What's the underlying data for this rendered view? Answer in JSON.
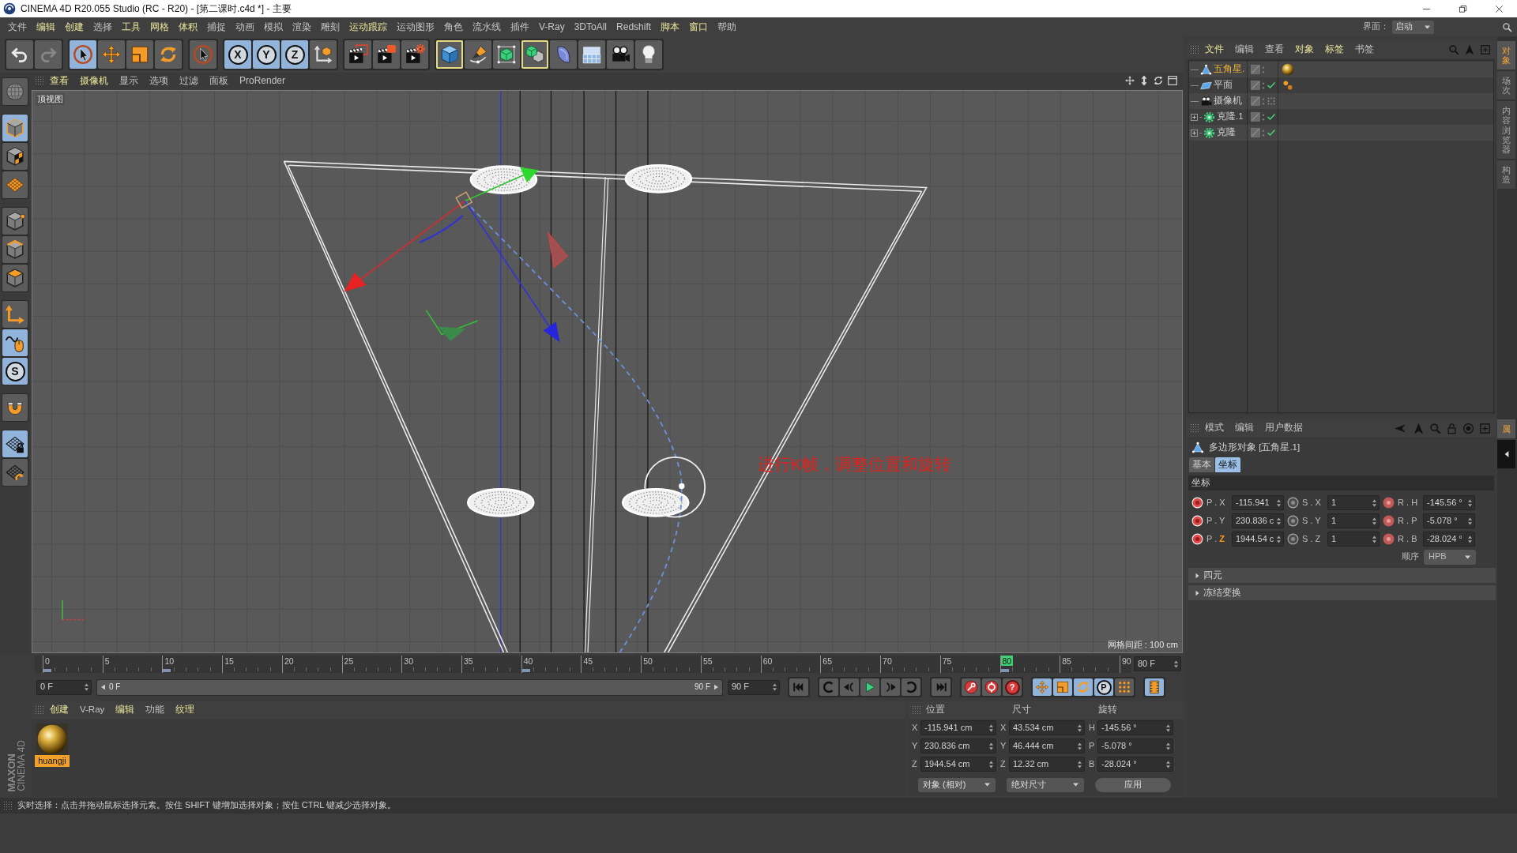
{
  "window": {
    "title": "CINEMA 4D R20.055 Studio (RC - R20) - [第二课时.c4d *] - 主要"
  },
  "menu_bar": {
    "items": [
      {
        "label": "文件",
        "highlighted": false
      },
      {
        "label": "编辑",
        "highlighted": true
      },
      {
        "label": "创建",
        "highlighted": true
      },
      {
        "label": "选择",
        "highlighted": false
      },
      {
        "label": "工具",
        "highlighted": true
      },
      {
        "label": "网格",
        "highlighted": true
      },
      {
        "label": "体积",
        "highlighted": true
      },
      {
        "label": "捕捉",
        "highlighted": false
      },
      {
        "label": "动画",
        "highlighted": false
      },
      {
        "label": "模拟",
        "highlighted": false
      },
      {
        "label": "渲染",
        "highlighted": false
      },
      {
        "label": "雕刻",
        "highlighted": false
      },
      {
        "label": "运动跟踪",
        "highlighted": true
      },
      {
        "label": "运动图形",
        "highlighted": false
      },
      {
        "label": "角色",
        "highlighted": false
      },
      {
        "label": "流水线",
        "highlighted": false
      },
      {
        "label": "插件",
        "highlighted": false
      },
      {
        "label": "V-Ray",
        "highlighted": false
      },
      {
        "label": "3DToAll",
        "highlighted": false
      },
      {
        "label": "Redshift",
        "highlighted": false
      },
      {
        "label": "脚本",
        "highlighted": true
      },
      {
        "label": "窗口",
        "highlighted": true
      },
      {
        "label": "帮助",
        "highlighted": false
      }
    ],
    "layout": {
      "label": "界面：",
      "value": "启动"
    }
  },
  "toolbar": [
    {
      "tools": [
        {
          "kind": "undo",
          "selected": false,
          "highlighted": false,
          "disabled": false
        },
        {
          "kind": "redo",
          "selected": false,
          "highlighted": false,
          "disabled": true
        }
      ]
    },
    {
      "tools": [
        {
          "kind": "select",
          "selected": true,
          "highlighted": false,
          "disabled": false
        },
        {
          "kind": "move",
          "selected": false,
          "highlighted": false,
          "disabled": false
        },
        {
          "kind": "scale",
          "selected": false,
          "highlighted": false,
          "disabled": false
        },
        {
          "kind": "rotate",
          "selected": false,
          "highlighted": false,
          "disabled": false
        }
      ]
    },
    {
      "tools": [
        {
          "kind": "recent",
          "selected": false,
          "highlighted": false,
          "disabled": false
        }
      ]
    },
    {
      "tools": [
        {
          "kind": "axis",
          "glyph": "X",
          "selected": true,
          "highlighted": false,
          "disabled": false
        },
        {
          "kind": "axis",
          "glyph": "Y",
          "selected": true,
          "highlighted": false,
          "disabled": false
        },
        {
          "kind": "axis",
          "glyph": "Z",
          "selected": true,
          "highlighted": false,
          "disabled": false
        },
        {
          "kind": "coords",
          "selected": false,
          "highlighted": false,
          "disabled": false
        }
      ]
    },
    {
      "tools": [
        {
          "kind": "render-view",
          "selected": false,
          "highlighted": false,
          "disabled": false
        },
        {
          "kind": "render-picture",
          "selected": false,
          "highlighted": false,
          "disabled": false
        },
        {
          "kind": "render-settings",
          "selected": false,
          "highlighted": false,
          "disabled": false
        }
      ]
    },
    {
      "tools": [
        {
          "kind": "cube",
          "selected": false,
          "highlighted": true,
          "disabled": false
        },
        {
          "kind": "pen",
          "selected": false,
          "highlighted": false,
          "disabled": false
        },
        {
          "kind": "subdivision",
          "selected": false,
          "highlighted": false,
          "disabled": false
        },
        {
          "kind": "cloner",
          "selected": false,
          "highlighted": true,
          "disabled": false
        },
        {
          "kind": "deformer",
          "selected": false,
          "highlighted": false,
          "disabled": false
        },
        {
          "kind": "floor",
          "selected": false,
          "highlighted": false,
          "disabled": false
        },
        {
          "kind": "camera",
          "selected": false,
          "highlighted": false,
          "disabled": false
        },
        {
          "kind": "light",
          "selected": false,
          "highlighted": false,
          "disabled": false
        }
      ]
    }
  ],
  "mode_toolbar": [
    {
      "tools": [
        {
          "kind": "model",
          "selected": false
        }
      ]
    },
    {
      "tools": [
        {
          "kind": "object",
          "selected": true
        },
        {
          "kind": "texture",
          "selected": false
        },
        {
          "kind": "workplane",
          "selected": false
        }
      ]
    },
    {
      "tools": [
        {
          "kind": "points",
          "selected": false
        },
        {
          "kind": "edges",
          "selected": false
        },
        {
          "kind": "polygons",
          "selected": false
        }
      ]
    },
    {
      "tools": [
        {
          "kind": "axis",
          "selected": false
        },
        {
          "kind": "tweak",
          "selected": true
        },
        {
          "kind": "snap",
          "glyph": "S",
          "selected": true
        }
      ]
    },
    {
      "tools": [
        {
          "kind": "magnet",
          "selected": false
        }
      ]
    },
    {
      "tools": [
        {
          "kind": "workplane-lock",
          "selected": true
        },
        {
          "kind": "planar",
          "selected": false
        }
      ]
    }
  ],
  "viewport": {
    "menu": [
      {
        "label": "查看",
        "highlighted": true
      },
      {
        "label": "摄像机",
        "highlighted": true
      },
      {
        "label": "显示",
        "highlighted": false
      },
      {
        "label": "选项",
        "highlighted": false
      },
      {
        "label": "过滤",
        "highlighted": false
      },
      {
        "label": "面板",
        "highlighted": false
      },
      {
        "label": "ProRender",
        "highlighted": false
      }
    ],
    "view_name": "顶视图",
    "annotation": "进行K帧，调整位置和旋转",
    "grid_spacing": "网格间距 : 100 cm"
  },
  "timeline": {
    "ticks": [
      {
        "label": "0",
        "keyed": true,
        "current": false
      },
      {
        "label": "5",
        "keyed": false,
        "current": false
      },
      {
        "label": "10",
        "keyed": true,
        "current": false
      },
      {
        "label": "15",
        "keyed": false,
        "current": false
      },
      {
        "label": "20",
        "keyed": false,
        "current": false
      },
      {
        "label": "25",
        "keyed": false,
        "current": false
      },
      {
        "label": "30",
        "keyed": false,
        "current": false
      },
      {
        "label": "35",
        "keyed": false,
        "current": false
      },
      {
        "label": "40",
        "keyed": true,
        "current": false
      },
      {
        "label": "45",
        "keyed": false,
        "current": false
      },
      {
        "label": "50",
        "keyed": false,
        "current": false
      },
      {
        "label": "55",
        "keyed": false,
        "current": false
      },
      {
        "label": "60",
        "keyed": false,
        "current": false
      },
      {
        "label": "65",
        "keyed": false,
        "current": false
      },
      {
        "label": "70",
        "keyed": false,
        "current": false
      },
      {
        "label": "75",
        "keyed": false,
        "current": false
      },
      {
        "label": "80",
        "keyed": true,
        "current": true
      },
      {
        "label": "85",
        "keyed": false,
        "current": false
      },
      {
        "label": "90",
        "keyed": false,
        "current": false
      }
    ],
    "current_field": "80 F"
  },
  "transport": {
    "start_field": "0 F",
    "range": {
      "start": "0 F",
      "end": "90 F",
      "level": 1
    },
    "end_field": "90 F",
    "buttons": [
      {
        "buttons": [
          {
            "kind": "go-start",
            "selected": false
          }
        ]
      },
      {
        "buttons": [
          {
            "kind": "prev-key",
            "selected": false
          },
          {
            "kind": "prev-frame",
            "selected": false
          },
          {
            "kind": "play",
            "selected": false
          },
          {
            "kind": "next-frame",
            "selected": false
          },
          {
            "kind": "next-key",
            "selected": false
          }
        ]
      },
      {
        "buttons": [
          {
            "kind": "go-end",
            "selected": false
          }
        ]
      },
      {
        "buttons": [
          {
            "kind": "record",
            "selected": false
          },
          {
            "kind": "autokey",
            "selected": false
          },
          {
            "kind": "key-selection",
            "glyph": "?",
            "selected": false
          }
        ]
      },
      {
        "buttons": [
          {
            "kind": "key-position",
            "selected": true
          },
          {
            "kind": "key-scale",
            "selected": true
          },
          {
            "kind": "key-rotation",
            "selected": true
          },
          {
            "kind": "key-parameter",
            "glyph": "P",
            "selected": true
          },
          {
            "kind": "key-points",
            "selected": false
          }
        ]
      },
      {
        "buttons": [
          {
            "kind": "timeline",
            "selected": true
          }
        ]
      }
    ]
  },
  "material_manager": {
    "menu": [
      {
        "label": "创建",
        "highlighted": true
      },
      {
        "label": "V-Ray",
        "highlighted": false
      },
      {
        "label": "编辑",
        "highlighted": true
      },
      {
        "label": "功能",
        "highlighted": false
      },
      {
        "label": "纹理",
        "highlighted": true
      }
    ],
    "materials": [
      {
        "name": "huangji",
        "selected": true
      }
    ]
  },
  "logo": {
    "lines": [
      "MAXON",
      "CINEMA 4D"
    ]
  },
  "coordinates_manager": {
    "headers": [
      "位置",
      "尺寸",
      "旋转"
    ],
    "rows": [
      {
        "cells": [
          {
            "axis": "X",
            "value": "-115.941 cm"
          },
          {
            "axis": "X",
            "value": "43.534 cm"
          },
          {
            "axis": "H",
            "value": "-145.56 °"
          }
        ]
      },
      {
        "cells": [
          {
            "axis": "Y",
            "value": "230.836 cm"
          },
          {
            "axis": "Y",
            "value": "46.444 cm"
          },
          {
            "axis": "P",
            "value": "-5.078 °"
          }
        ]
      },
      {
        "cells": [
          {
            "axis": "Z",
            "value": "1944.54 cm"
          },
          {
            "axis": "Z",
            "value": "12.32 cm"
          },
          {
            "axis": "B",
            "value": "-28.024 °"
          }
        ]
      }
    ],
    "mode_dropdown": "对象 (相对)",
    "size_dropdown": "绝对尺寸",
    "apply_button": "应用"
  },
  "object_manager": {
    "menu": [
      {
        "label": "文件",
        "highlighted": true
      },
      {
        "label": "编辑",
        "highlighted": false
      },
      {
        "label": "查看",
        "highlighted": false
      },
      {
        "label": "对象",
        "highlighted": true
      },
      {
        "label": "标签",
        "highlighted": true
      },
      {
        "label": "书签",
        "highlighted": false
      }
    ],
    "objects": [
      {
        "name": "五角星.",
        "kind": "polygon",
        "selected": true,
        "enabled": false,
        "tags": [
          {
            "kind": "material"
          }
        ]
      },
      {
        "name": "平面",
        "kind": "plane",
        "selected": false,
        "enabled": true,
        "tags": [
          {
            "kind": "selection"
          }
        ]
      },
      {
        "name": "摄像机",
        "kind": "camera",
        "selected": false,
        "enabled": false
      },
      {
        "name": "克隆.1",
        "kind": "cloner",
        "selected": false,
        "expanded": false,
        "enabled": true
      },
      {
        "name": "克隆",
        "kind": "cloner",
        "selected": false,
        "expanded": false,
        "enabled": true
      }
    ]
  },
  "attribute_manager": {
    "menu": [
      {
        "label": "模式",
        "highlighted": false
      },
      {
        "label": "编辑",
        "highlighted": false
      },
      {
        "label": "用户数据",
        "highlighted": false
      }
    ],
    "object": {
      "kind": "polygon",
      "title": "多边形对象 [五角星.1]"
    },
    "tabs": [
      {
        "label": "基本",
        "selected": false
      },
      {
        "label": "坐标",
        "selected": true
      }
    ],
    "section": "坐标",
    "rows": [
      {
        "cells": [
          {
            "label": "P . ",
            "axis": "X",
            "axis_highlighted": false,
            "animated": true,
            "keyed": true,
            "value": "-115.941"
          },
          {
            "label": "S . ",
            "axis": "X",
            "axis_highlighted": false,
            "animated": false,
            "keyed": false,
            "value": "1"
          },
          {
            "label": "R . ",
            "axis": "H",
            "axis_highlighted": false,
            "animated": true,
            "keyed": false,
            "value": "-145.56 °"
          }
        ]
      },
      {
        "cells": [
          {
            "label": "P . ",
            "axis": "Y",
            "axis_highlighted": false,
            "animated": true,
            "keyed": true,
            "value": "230.836 c"
          },
          {
            "label": "S . ",
            "axis": "Y",
            "axis_highlighted": false,
            "animated": false,
            "keyed": false,
            "value": "1"
          },
          {
            "label": "R . ",
            "axis": "P",
            "axis_highlighted": false,
            "animated": true,
            "keyed": false,
            "value": "-5.078 °"
          }
        ]
      },
      {
        "cells": [
          {
            "label": "P . ",
            "axis": "Z",
            "axis_highlighted": true,
            "animated": true,
            "keyed": true,
            "value": "1944.54 c"
          },
          {
            "label": "S . ",
            "axis": "Z",
            "axis_highlighted": false,
            "animated": false,
            "keyed": false,
            "value": "1"
          },
          {
            "label": "R . ",
            "axis": "B",
            "axis_highlighted": false,
            "animated": true,
            "keyed": false,
            "value": "-28.024 °"
          }
        ]
      }
    ],
    "order_label": "顺序",
    "order_value": "HPB",
    "groups": [
      {
        "label": "四元",
        "expanded": false
      },
      {
        "label": "冻结变换",
        "expanded": false
      }
    ]
  },
  "side_tabs": [
    {
      "label": "对象",
      "selected": true
    },
    {
      "label": "场次",
      "selected": false
    },
    {
      "label": "内容浏览器",
      "selected": false
    },
    {
      "label": "构造",
      "selected": false
    }
  ],
  "attribute_side_tabs": [
    {
      "label": "属",
      "selected": true
    }
  ],
  "status_bar": {
    "text": "实时选择：点击并拖动鼠标选择元素。按住 SHIFT 键增加选择对象；按住 CTRL 键减少选择对象。"
  }
}
